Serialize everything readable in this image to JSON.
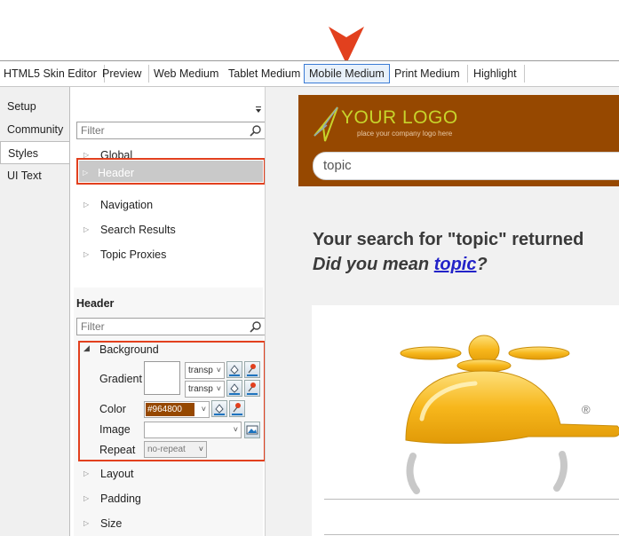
{
  "colors": {
    "accent": "#e2401e",
    "header_bg": "#964800",
    "logo": "#c7d42b",
    "link": "#2323c8",
    "active_tab_border": "#3a7bd5"
  },
  "top_tabs": [
    {
      "label": "HTML5 Skin Editor"
    },
    {
      "label": "Preview"
    },
    {
      "label": "Web Medium"
    },
    {
      "label": "Tablet Medium"
    },
    {
      "label": "Mobile Medium",
      "active": true
    },
    {
      "label": "Print Medium"
    },
    {
      "label": "Highlight"
    }
  ],
  "left_tabs": [
    {
      "label": "Setup"
    },
    {
      "label": "Community"
    },
    {
      "label": "Styles",
      "active": true
    },
    {
      "label": "UI Text"
    }
  ],
  "filter_top": {
    "placeholder": "Filter"
  },
  "tree": [
    {
      "label": "Global"
    },
    {
      "label": "Header",
      "selected": true
    },
    {
      "label": "Navigation"
    },
    {
      "label": "Search Results"
    },
    {
      "label": "Topic Proxies"
    }
  ],
  "section": {
    "title": "Header"
  },
  "filter_props": {
    "placeholder": "Filter"
  },
  "properties": {
    "group": "Background",
    "gradient_label": "Gradient",
    "gradient_dd1": "transp",
    "gradient_dd2": "transp",
    "color_label": "Color",
    "color_value": "#964800",
    "image_label": "Image",
    "image_value": "",
    "repeat_label": "Repeat",
    "repeat_value": "no-repeat"
  },
  "more_groups": [
    {
      "label": "Layout"
    },
    {
      "label": "Padding"
    },
    {
      "label": "Size"
    }
  ],
  "preview": {
    "logo_text": "YOUR LOGO",
    "logo_sub": "place your company logo here",
    "search_value": "topic",
    "result_line": "Your search for \"topic\" returned",
    "did_you_mean": "Did you mean ",
    "suggestion": "topic",
    "question_mark": "?",
    "registered": "®"
  }
}
